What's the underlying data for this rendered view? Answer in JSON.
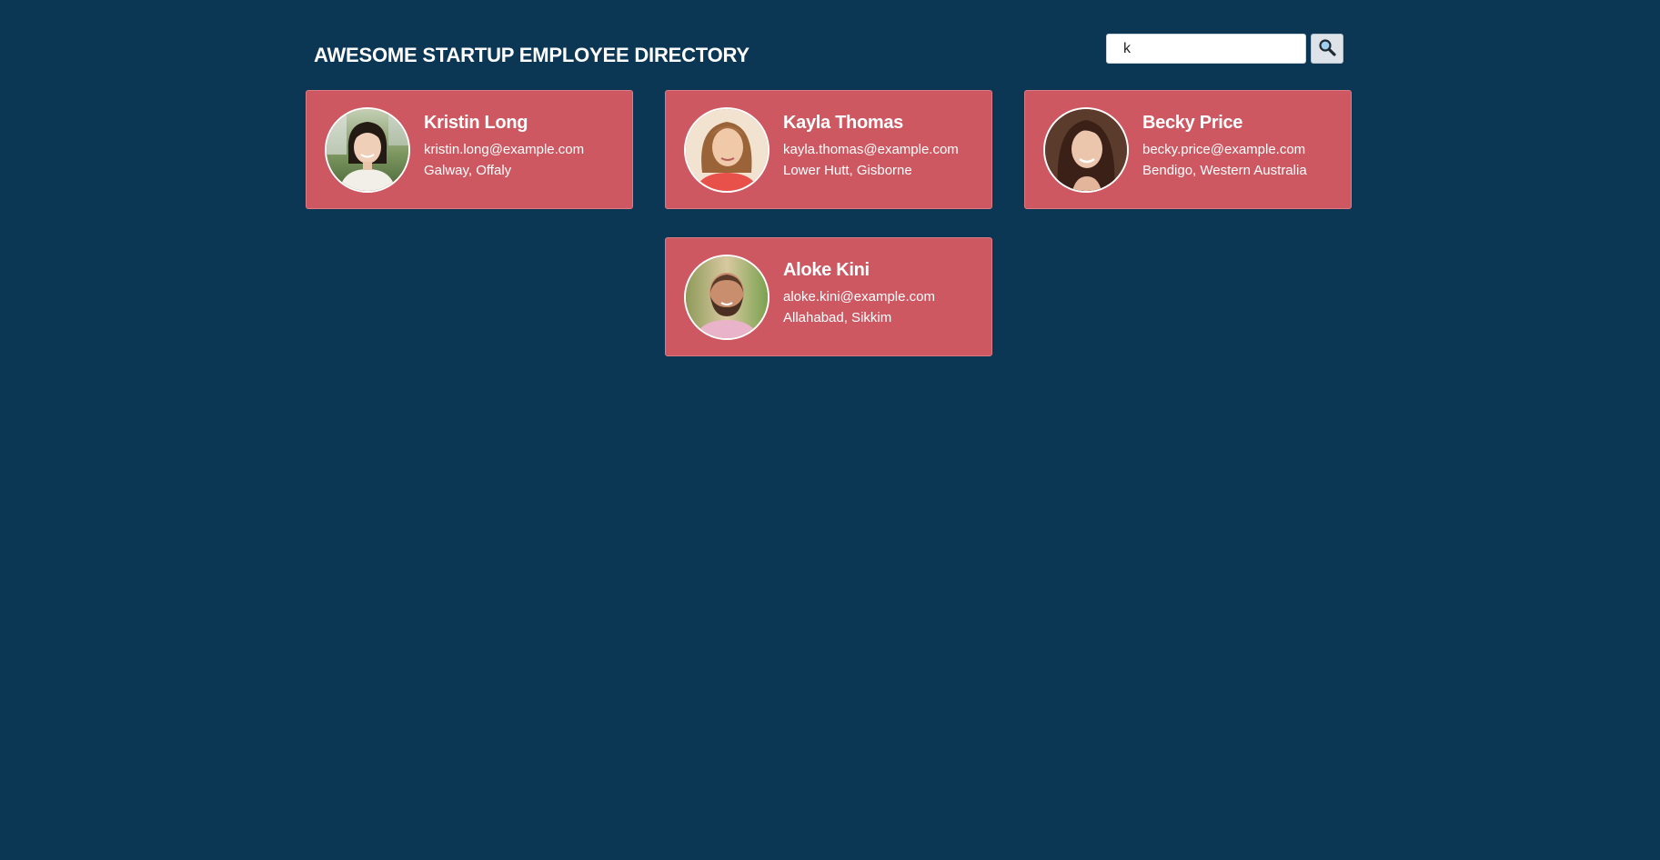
{
  "header": {
    "title": "AWESOME STARTUP EMPLOYEE DIRECTORY"
  },
  "search": {
    "value": "k",
    "button_icon": "search-icon"
  },
  "colors": {
    "background": "#0b3654",
    "card": "#cd5861"
  },
  "employees": [
    {
      "name": "Kristin Long",
      "email": "kristin.long@example.com",
      "location": "Galway, Offaly"
    },
    {
      "name": "Kayla Thomas",
      "email": "kayla.thomas@example.com",
      "location": "Lower Hutt, Gisborne"
    },
    {
      "name": "Becky Price",
      "email": "becky.price@example.com",
      "location": "Bendigo, Western Australia"
    },
    {
      "name": "Aloke Kini",
      "email": "aloke.kini@example.com",
      "location": "Allahabad, Sikkim"
    }
  ]
}
